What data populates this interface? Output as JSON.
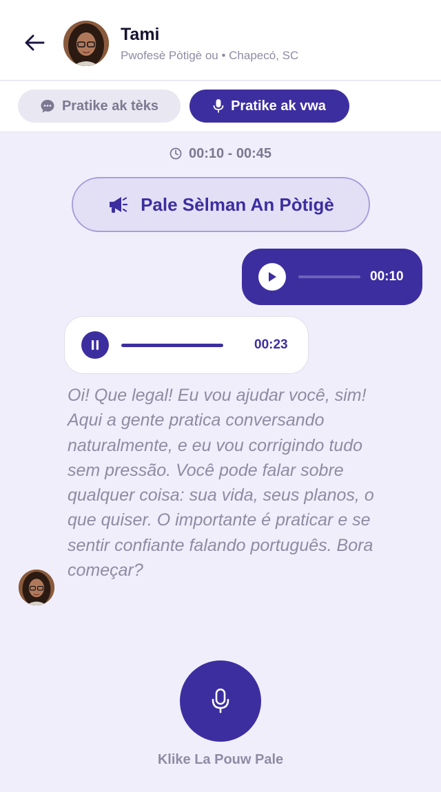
{
  "header": {
    "name": "Tami",
    "subtitle": "Pwofesè Pòtigè ou • Chapecó, SC"
  },
  "tabs": [
    {
      "label": "Pratike ak tèks",
      "icon": "chat-bubble-icon",
      "active": false
    },
    {
      "label": "Pratike ak vwa",
      "icon": "microphone-icon",
      "active": true
    }
  ],
  "session": {
    "time_range": "00:10 - 00:45",
    "clock_icon": "clock-icon"
  },
  "banner": {
    "label": "Pale Sèlman An Pòtigè",
    "icon": "megaphone-icon"
  },
  "messages": {
    "sent_voice": {
      "duration": "00:10",
      "progress": 0
    },
    "received_voice": {
      "duration": "00:23",
      "progress": 1
    },
    "transcript": "Oi! Que legal! Eu vou ajudar você, sim! Aqui a gente pratica conversando naturalmente, e eu vou corrigindo tudo sem pressão. Você pode falar sobre qualquer coisa: sua vida, seus planos, o que quiser. O importante é praticar e se sentir confiante falando português. Bora começar?"
  },
  "record": {
    "hint": "Klike La Pouw Pale",
    "icon": "microphone-icon"
  },
  "colors": {
    "accent": "#3d2ea0",
    "background": "#f0eefb",
    "muted_text": "#8f8ba3"
  }
}
